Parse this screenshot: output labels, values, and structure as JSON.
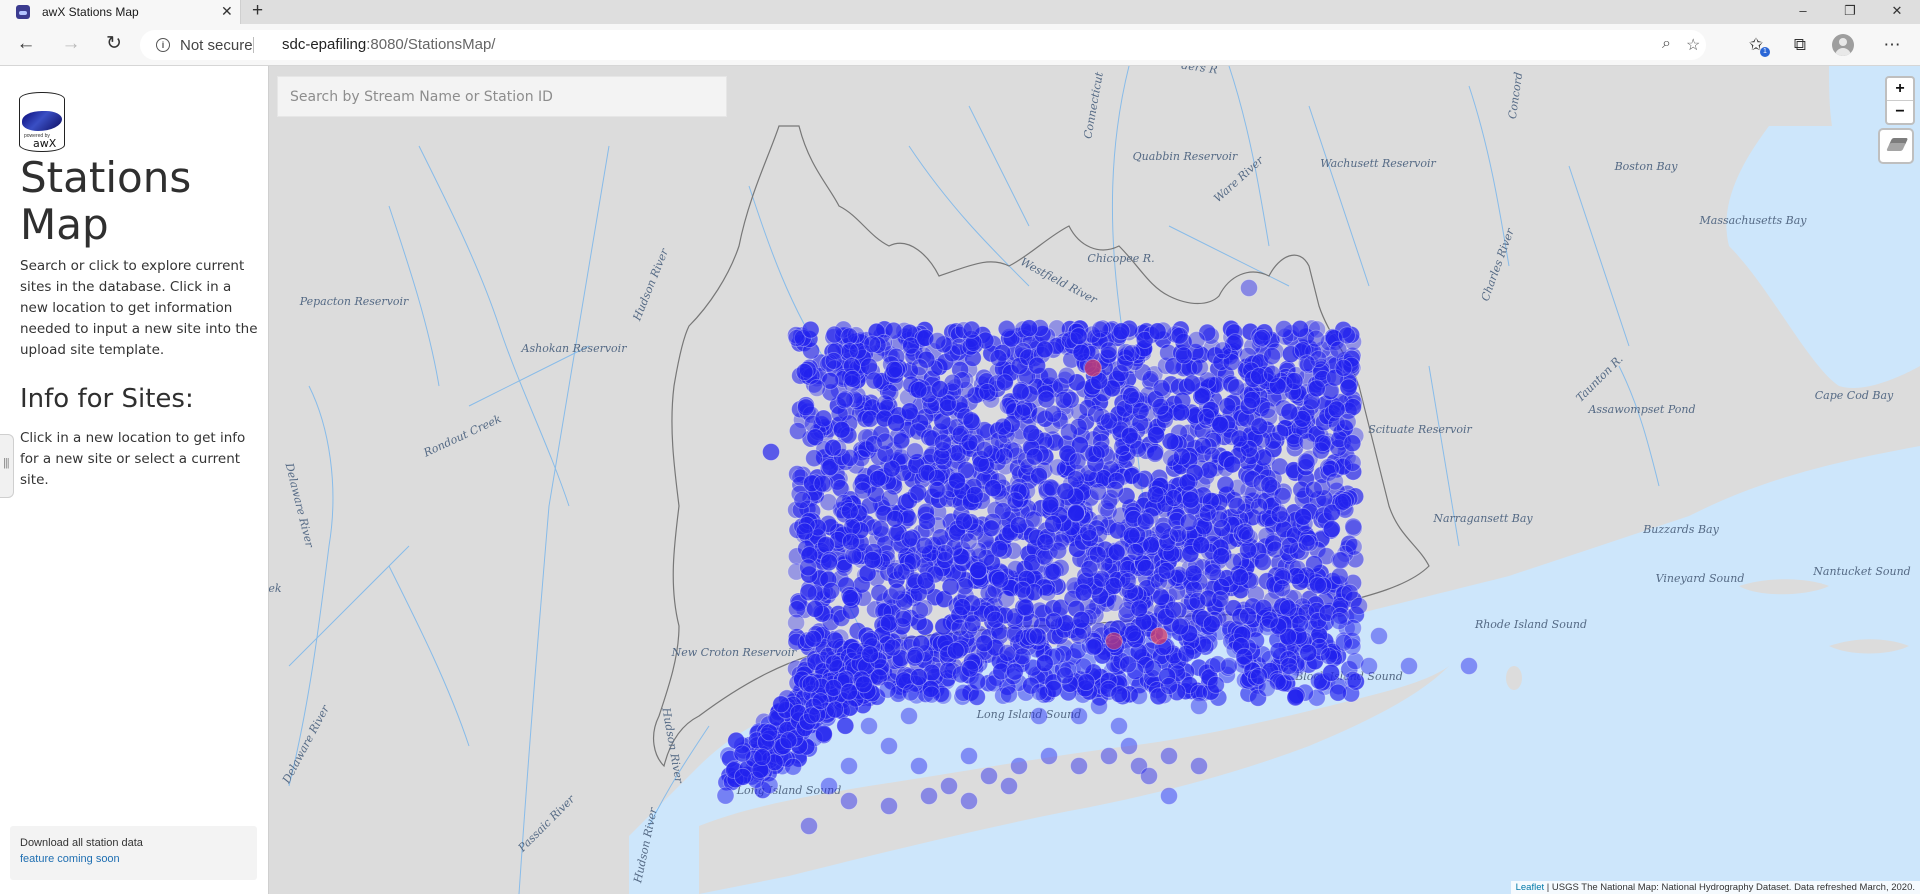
{
  "browser": {
    "tab_title": "awX Stations Map",
    "tab_close": "✕",
    "new_tab": "+",
    "security_label": "Not secure",
    "url_host": "sdc-epafiling",
    "url_rest": ":8080/StationsMap/",
    "window_controls": [
      "–",
      "❐",
      "✕"
    ]
  },
  "sidebar": {
    "logo_small_text": "powered by",
    "logo_text": "awX",
    "title": "Stations Map",
    "description": "Search or click to explore current sites in the database. Click in a new location to get information needed to input a new site into the upload site template.",
    "info_title": "Info for Sites:",
    "info_text": "Click in a new location to get info for a new site or select a current site.",
    "download_label": "Download all station data",
    "download_link": "feature coming soon"
  },
  "map": {
    "search_placeholder": "Search by Stream Name or Station ID",
    "zoom_in": "+",
    "zoom_out": "−",
    "attribution_link": "Leaflet",
    "attribution_text": " | USGS The National Map: National Hydrography Dataset. Data refreshed March, 2020.",
    "colors": {
      "land": "#dcdcdc",
      "water": "#cde6fb",
      "rivers": "#79b6ec",
      "stations": "#2222ee",
      "highlight": "#ff4444"
    },
    "labels": [
      {
        "text": "Quabbin Reservoir"
      },
      {
        "text": "Wachusett Reservoir"
      },
      {
        "text": "Ware River"
      },
      {
        "text": "Boston Bay"
      },
      {
        "text": "Massachusetts Bay"
      },
      {
        "text": "Pepacton Reservoir"
      },
      {
        "text": "Ashokan Reservoir"
      },
      {
        "text": "Hudson River"
      },
      {
        "text": "Westfield River"
      },
      {
        "text": "Chicopee R."
      },
      {
        "text": "Connecticut"
      },
      {
        "text": "Concord"
      },
      {
        "text": "Charles River"
      },
      {
        "text": "Taunton R."
      },
      {
        "text": "Assawompset Pond"
      },
      {
        "text": "Cape Cod Bay"
      },
      {
        "text": "Rondout Creek"
      },
      {
        "text": "Scituate Reservoir"
      },
      {
        "text": "Delaware River"
      },
      {
        "text": "Narragansett Bay"
      },
      {
        "text": "Buzzards Bay"
      },
      {
        "text": "Nantucket Sound"
      },
      {
        "text": "Vineyard Sound"
      },
      {
        "text": "Rhode Island Sound"
      },
      {
        "text": "New Croton Reservoir"
      },
      {
        "text": "Block Island Sound"
      },
      {
        "text": "Long Island Sound"
      },
      {
        "text": "Long Island Sound"
      },
      {
        "text": "Hudson River"
      },
      {
        "text": "Delaware River"
      },
      {
        "text": "Passaic River"
      },
      {
        "text": "Hudson River"
      },
      {
        "text": "ders R"
      },
      {
        "text": "ek"
      }
    ]
  }
}
